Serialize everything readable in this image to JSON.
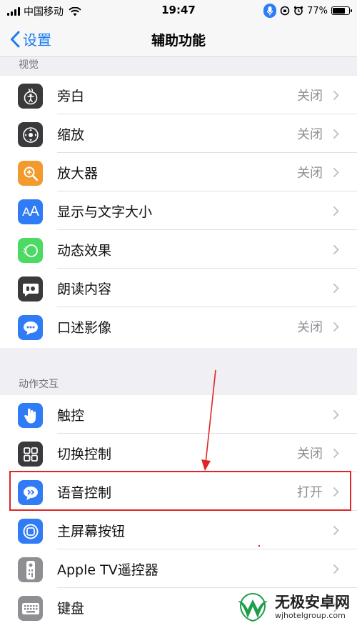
{
  "status_bar": {
    "carrier": "中国移动",
    "time": "19:47",
    "battery_text": "77%",
    "battery_level": 0.77
  },
  "nav": {
    "back_label": "设置",
    "title": "辅助功能"
  },
  "sections": [
    {
      "header": "视觉",
      "rows": [
        {
          "label": "旁白",
          "value": "关闭",
          "icon": "voiceover-icon",
          "color": "#3a3a3c"
        },
        {
          "label": "缩放",
          "value": "关闭",
          "icon": "zoom-icon",
          "color": "#3a3a3c"
        },
        {
          "label": "放大器",
          "value": "关闭",
          "icon": "magnifier-icon",
          "color": "#f29a2e"
        },
        {
          "label": "显示与文字大小",
          "value": "",
          "icon": "text-size-icon",
          "color": "#2f7cf6"
        },
        {
          "label": "动态效果",
          "value": "",
          "icon": "motion-icon",
          "color": "#4cd964"
        },
        {
          "label": "朗读内容",
          "value": "",
          "icon": "spoken-content-icon",
          "color": "#3a3a3c"
        },
        {
          "label": "口述影像",
          "value": "关闭",
          "icon": "audio-description-icon",
          "color": "#2f7cf6"
        }
      ]
    },
    {
      "header": "动作交互",
      "rows": [
        {
          "label": "触控",
          "value": "",
          "icon": "touch-icon",
          "color": "#2f7cf6"
        },
        {
          "label": "切换控制",
          "value": "关闭",
          "icon": "switch-control-icon",
          "color": "#3a3a3c"
        },
        {
          "label": "语音控制",
          "value": "打开",
          "icon": "voice-control-icon",
          "color": "#2f7cf6"
        },
        {
          "label": "主屏幕按钮",
          "value": "",
          "icon": "home-button-icon",
          "color": "#2f7cf6"
        },
        {
          "label": "Apple TV遥控器",
          "value": "",
          "icon": "tv-remote-icon",
          "color": "#8e8e93"
        },
        {
          "label": "键盘",
          "value": "",
          "icon": "keyboard-icon",
          "color": "#8e8e93"
        }
      ]
    }
  ],
  "colors": {
    "accent": "#1a7cf5",
    "highlight": "#e02525"
  },
  "watermark": {
    "title": "无极安卓网",
    "url": "wjhotelgroup.com"
  }
}
